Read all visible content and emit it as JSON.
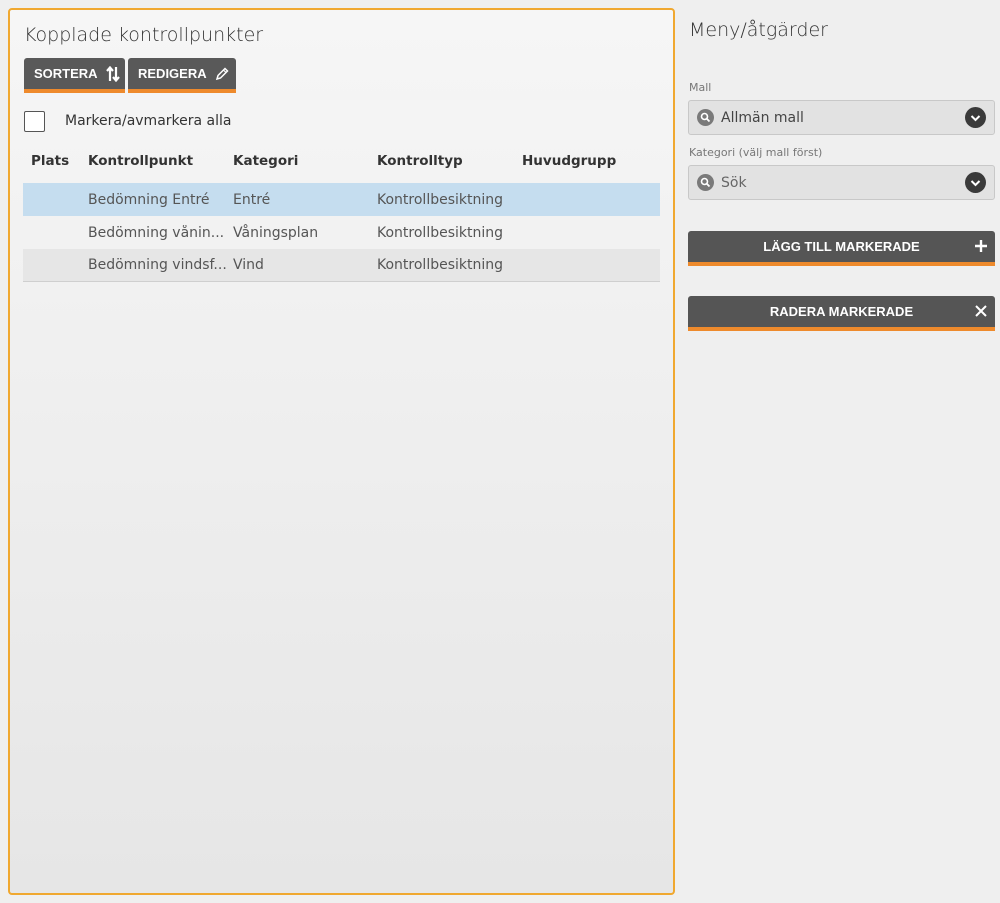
{
  "left": {
    "title": "Kopplade kontrollpunkter",
    "sort_label": "SORTERA",
    "edit_label": "REDIGERA",
    "select_all_label": "Markera/avmarkera alla",
    "columns": [
      "Plats",
      "Kontrollpunkt",
      "Kategori",
      "Kontrolltyp",
      "Huvudgrupp"
    ],
    "rows": [
      {
        "plats": "",
        "kontrollpunkt": "Bedömning Entré",
        "kategori": "Entré",
        "kontrolltyp": "Kontrollbesiktning",
        "huvudgrupp": ""
      },
      {
        "plats": "",
        "kontrollpunkt": "Bedömning vånin...",
        "kategori": "Våningsplan",
        "kontrolltyp": "Kontrollbesiktning",
        "huvudgrupp": ""
      },
      {
        "plats": "",
        "kontrollpunkt": "Bedömning vindsf...",
        "kategori": "Vind",
        "kontrolltyp": "Kontrollbesiktning",
        "huvudgrupp": ""
      }
    ]
  },
  "right": {
    "title": "Meny/åtgärder",
    "mall_label": "Mall",
    "mall_value": "Allmän mall",
    "kategori_label": "Kategori (välj mall först)",
    "kategori_placeholder": "Sök",
    "add_label": "LÄGG TILL MARKERADE",
    "delete_label": "RADERA MARKERADE"
  },
  "colors": {
    "accent": "#ee8a2c",
    "panel_border": "#f0a830",
    "button_bg": "#555555",
    "selected_row": "#c5ddef"
  },
  "icons": [
    "sort-icon",
    "pencil-icon",
    "search-icon",
    "chevron-down-icon",
    "plus-icon",
    "close-icon"
  ]
}
